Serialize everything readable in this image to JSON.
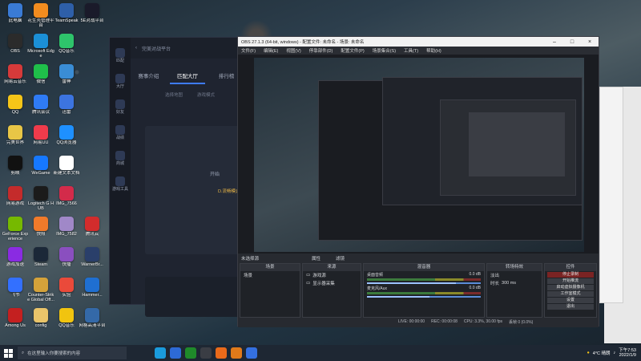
{
  "desktop": {
    "icons": [
      {
        "label": "此电脑",
        "color": "#3a7bd5",
        "col": 0,
        "row": 0
      },
      {
        "label": "花生壳管理平台",
        "color": "#f28c1f",
        "col": 1,
        "row": 0
      },
      {
        "label": "TeamSpeak",
        "color": "#2e5fa8",
        "col": 2,
        "row": 0
      },
      {
        "label": "5E对战平台",
        "color": "#1a1a2a",
        "col": 3,
        "row": 0
      },
      {
        "label": "OBS",
        "color": "#2b2b2b",
        "col": 0,
        "row": 1
      },
      {
        "label": "Microsoft Edge",
        "color": "#1b8fd6",
        "col": 1,
        "row": 1
      },
      {
        "label": "QQ音乐",
        "color": "#2ec46b",
        "col": 2,
        "row": 1
      },
      {
        "label": "网易云音乐",
        "color": "#d63a3a",
        "col": 0,
        "row": 2
      },
      {
        "label": "微信",
        "color": "#1fbf4a",
        "col": 1,
        "row": 2
      },
      {
        "label": "雷神",
        "color": "#3a8dd5",
        "col": 2,
        "row": 2
      },
      {
        "label": "QQ",
        "color": "#f5c518",
        "col": 0,
        "row": 3
      },
      {
        "label": "腾讯会议",
        "color": "#2f7bf5",
        "col": 1,
        "row": 3
      },
      {
        "label": "迅雷",
        "color": "#3c74e0",
        "col": 2,
        "row": 3
      },
      {
        "label": "完美世界",
        "color": "#e8c646",
        "col": 0,
        "row": 4
      },
      {
        "label": "网易UU",
        "color": "#ef3b4b",
        "col": 1,
        "row": 4
      },
      {
        "label": "QQ浏览器",
        "color": "#1e90ff",
        "col": 2,
        "row": 4
      },
      {
        "label": "剪映",
        "color": "#111111",
        "col": 0,
        "row": 5
      },
      {
        "label": "WeGame",
        "color": "#1678ff",
        "col": 1,
        "row": 5
      },
      {
        "label": "新建文本文档",
        "color": "#ffffff",
        "col": 2,
        "row": 5
      },
      {
        "label": "网易游戏",
        "color": "#c42b2b",
        "col": 0,
        "row": 6
      },
      {
        "label": "Logitech G HUB",
        "color": "#1b1b1b",
        "col": 1,
        "row": 6
      },
      {
        "label": "IMG_7566",
        "color": "#d32b4a",
        "col": 2,
        "row": 6
      },
      {
        "label": "GeForce Experience",
        "color": "#76b900",
        "col": 0,
        "row": 7
      },
      {
        "label": "快照",
        "color": "#f07a2a",
        "col": 1,
        "row": 7
      },
      {
        "label": "IMG_7582",
        "color": "#a088c8",
        "col": 2,
        "row": 7
      },
      {
        "label": "腾讯云",
        "color": "#d22c2c",
        "col": 3,
        "row": 7
      },
      {
        "label": "游戏加速",
        "color": "#8a2be2",
        "col": 0,
        "row": 8
      },
      {
        "label": "Steam",
        "color": "#1b2838",
        "col": 1,
        "row": 8
      },
      {
        "label": "快播",
        "color": "#8a4fbf",
        "col": 2,
        "row": 8
      },
      {
        "label": "WarnerBr...",
        "color": "#2a3f6a",
        "col": 3,
        "row": 8
      },
      {
        "label": "飞书",
        "color": "#3370ff",
        "col": 0,
        "row": 9
      },
      {
        "label": "Counter-Strike Global Off...",
        "color": "#d4a23a",
        "col": 1,
        "row": 9
      },
      {
        "label": "实验",
        "color": "#ea4a3a",
        "col": 2,
        "row": 9
      },
      {
        "label": "Hammer...",
        "color": "#1f6fd1",
        "col": 3,
        "row": 9
      },
      {
        "label": "Among Us",
        "color": "#c42020",
        "col": 0,
        "row": 10
      },
      {
        "label": "config",
        "color": "#e9c46a",
        "col": 1,
        "row": 10
      },
      {
        "label": "QQ音乐",
        "color": "#f1c40f",
        "col": 2,
        "row": 10
      },
      {
        "label": "网格高清平台",
        "color": "#3469a8",
        "col": 3,
        "row": 10
      }
    ]
  },
  "back_app": {
    "title": "完美对战平台",
    "tabs": [
      {
        "label": "赛事介绍",
        "active": false
      },
      {
        "label": "匹配大厅",
        "active": true
      },
      {
        "label": "排行榜",
        "active": false
      }
    ],
    "side_items": [
      "匹配",
      "大厅",
      "好友",
      "战绩",
      "商城",
      "游戏工具"
    ],
    "sub_tabs": [
      "选择地图",
      "游戏模式"
    ],
    "start_button": "开始",
    "notice": "D.流畅模式"
  },
  "obs": {
    "title": "OBS 27.1.3 (64-bit, windows) - 配置文件: 未命名 - 场景: 未命名",
    "menu": [
      "文件(F)",
      "编辑(E)",
      "视图(V)",
      "停靠部件(D)",
      "配置文件(P)",
      "场景集合(S)",
      "工具(T)",
      "帮助(H)"
    ],
    "source_bar": "未选择源",
    "properties": "属性",
    "filters": "滤镜",
    "docks": {
      "scenes": {
        "title": "场景",
        "items": [
          "场景"
        ]
      },
      "sources": {
        "title": "来源",
        "items": [
          "游戏源",
          "显示器采集"
        ]
      },
      "mixer": {
        "title": "混音器",
        "tracks": [
          {
            "name": "桌面音频",
            "db": "0.0 dB",
            "level": 0.78
          },
          {
            "name": "麦克风/Aux",
            "db": "0.0 dB",
            "level": 0.55
          }
        ]
      },
      "transitions": {
        "title": "转场特效",
        "type": "淡出",
        "duration_label": "时长",
        "duration": "300 ms"
      },
      "controls": {
        "title": "控件",
        "buttons": [
          {
            "label": "停止录制",
            "active": true
          },
          {
            "label": "开始推流",
            "active": false
          },
          {
            "label": "启动虚拟摄像机",
            "active": false
          },
          {
            "label": "工作室模式",
            "active": false
          },
          {
            "label": "设置",
            "active": false
          },
          {
            "label": "退出",
            "active": false
          }
        ]
      }
    },
    "status": [
      "LIVE: 00:00:00",
      "REC: 00:00:08",
      "CPU: 3.3%, 30.00 fps",
      "丢帧 0 (0.0%)"
    ]
  },
  "taskbar": {
    "search_placeholder": "在这里输入你要搜索的内容",
    "weather": "4°C 晴朗",
    "time": "下午7:53",
    "date": "2022/1/9",
    "apps": [
      "#1a9bdc",
      "#2d6ad6",
      "#1f8a2a",
      "#3a3d44",
      "#ea6a1a",
      "#e07a1a",
      "#3470e0"
    ]
  },
  "colors": {
    "obs_bg": "#1a1c21",
    "accent": "#3e7bff",
    "rec": "#7a2323"
  }
}
